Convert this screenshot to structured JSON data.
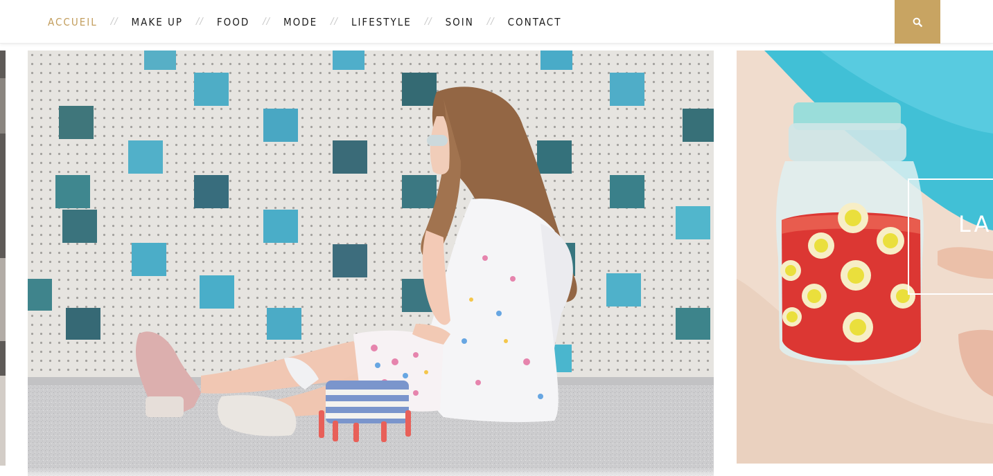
{
  "nav": {
    "items": [
      {
        "label": "ACCUEIL",
        "active": true
      },
      {
        "label": "MAKE UP",
        "active": false
      },
      {
        "label": "FOOD",
        "active": false
      },
      {
        "label": "MODE",
        "active": false
      },
      {
        "label": "LIFESTYLE",
        "active": false
      },
      {
        "label": "SOIN",
        "active": false
      },
      {
        "label": "CONTACT",
        "active": false
      }
    ],
    "separator": "//",
    "search_icon": "search-icon"
  },
  "slides": {
    "right_overlay_text": "LA"
  },
  "colors": {
    "accent": "#c8a462",
    "active_nav": "#c29d5c",
    "nav_text": "#1c1c1c",
    "separator": "#c9c9c9"
  }
}
